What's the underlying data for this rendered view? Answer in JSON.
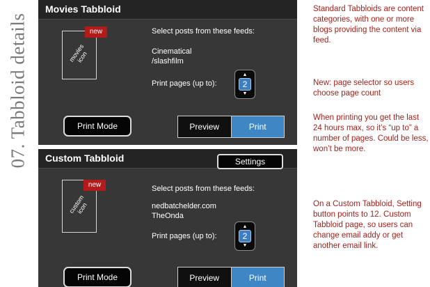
{
  "section_heading": "07. Tabbloid details",
  "tabbloids": {
    "movies": {
      "title": "Movies Tabbloid",
      "icon_label": "movies\nicon",
      "new_badge": "new",
      "feeds_prompt": "Select posts from these feeds:",
      "feeds": [
        "Cinematical",
        "/slashfilm"
      ],
      "pages_label": "Print pages (up to):",
      "pages_value": "2",
      "print_mode_label": "Print Mode",
      "preview_label": "Preview",
      "print_label": "Print"
    },
    "custom": {
      "title": "Custom Tabbloid",
      "settings_label": "Settings",
      "icon_label": "custom\nicon",
      "new_badge": "new",
      "feeds_prompt": "Select posts from these feeds:",
      "feeds": [
        "nedbatchelder.com",
        "TheOnda"
      ],
      "pages_label": "Print pages (up to):",
      "pages_value": "2",
      "print_mode_label": "Print Mode",
      "preview_label": "Preview",
      "print_label": "Print"
    }
  },
  "notes": [
    "Standard Tabbloids are content categories, with one or more blogs providing the content via feed.",
    "New: page selector so users choose page count",
    "When printing you get the last 24 hours max, so it’s “up to” a number of pages. Could be less, won’t be more.",
    "On a Custom Tabbloid, Setting button points to 12. Custom Tabbloid page, so users can change email addy or get another email link."
  ],
  "icons": {
    "stepper_up": "triangle-up-icon",
    "stepper_down": "triangle-down-icon"
  },
  "colors": {
    "panel_bg": "#373737",
    "header_bg": "#242424",
    "badge_red": "#b31a1a",
    "print_blue": "#3f86c4",
    "note_red": "#a3221b",
    "heading_gray": "#7a7a7a"
  }
}
